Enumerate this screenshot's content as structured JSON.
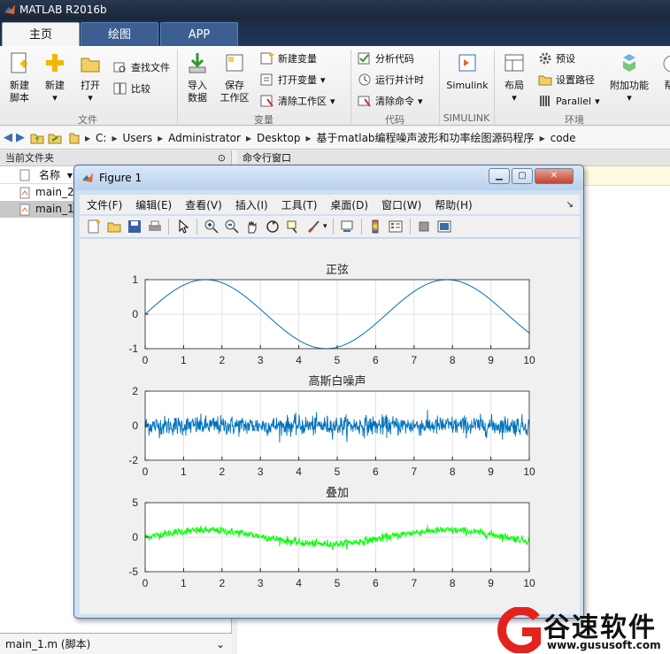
{
  "app": {
    "title": "MATLAB R2016b"
  },
  "tabs": [
    {
      "label": "主页"
    },
    {
      "label": "绘图"
    },
    {
      "label": "APP"
    }
  ],
  "ribbon": {
    "new_script": "新建\n脚本",
    "new": "新建",
    "open": "打开",
    "find_files": "查找文件",
    "compare": "比较",
    "import_data": "导入\n数据",
    "save_workspace": "保存\n工作区",
    "new_variable": "新建变量",
    "open_variable": "打开变量",
    "clear_workspace": "清除工作区",
    "analyze_code": "分析代码",
    "run_and_time": "运行并计时",
    "clear_commands": "清除命令",
    "simulink": "Simulink",
    "layout": "布局",
    "preferences": "预设",
    "set_path": "设置路径",
    "parallel": "Parallel",
    "addons": "附加功能",
    "help_partial": "帮",
    "groups": {
      "file": "文件",
      "variable": "变量",
      "code": "代码",
      "simulink": "SIMULINK",
      "environment": "环境"
    }
  },
  "address": {
    "crumbs": [
      "C:",
      "Users",
      "Administrator",
      "Desktop",
      "基于matlab编程噪声波形和功率绘图源码程序",
      "code"
    ]
  },
  "current_folder": {
    "title": "当前文件夹",
    "col_name": "名称",
    "files": [
      "main_2.m",
      "main_1.m"
    ],
    "status": "main_1.m  (脚本)"
  },
  "command_window": {
    "title": "命令行窗口"
  },
  "figure": {
    "title": "Figure 1",
    "menu": [
      "文件(F)",
      "编辑(E)",
      "查看(V)",
      "插入(I)",
      "工具(T)",
      "桌面(D)",
      "窗口(W)",
      "帮助(H)"
    ]
  },
  "watermark": {
    "text": "谷速软件",
    "url": "www.gususoft.com"
  },
  "colors": {
    "sine": "#0072bd",
    "noise": "#0072bd",
    "sum": "#00ff00",
    "accent": "#e4231e"
  },
  "chart_data": [
    {
      "type": "line",
      "title": "正弦",
      "xlim": [
        0,
        10
      ],
      "ylim": [
        -1,
        1
      ],
      "xticks": [
        0,
        1,
        2,
        3,
        4,
        5,
        6,
        7,
        8,
        9,
        10
      ],
      "yticks": [
        -1,
        0,
        1
      ],
      "grid": true,
      "series": [
        {
          "function": "sin(x)"
        }
      ]
    },
    {
      "type": "line",
      "title": "高斯白噪声",
      "xlim": [
        0,
        10
      ],
      "ylim": [
        -2,
        2
      ],
      "xticks": [
        0,
        1,
        2,
        3,
        4,
        5,
        6,
        7,
        8,
        9,
        10
      ],
      "yticks": [
        -2,
        0,
        2
      ],
      "grid": true,
      "series": [
        {
          "function": "gaussian noise, std≈0.3"
        }
      ]
    },
    {
      "type": "line",
      "title": "叠加",
      "xlim": [
        0,
        10
      ],
      "ylim": [
        -5,
        5
      ],
      "xticks": [
        0,
        1,
        2,
        3,
        4,
        5,
        6,
        7,
        8,
        9,
        10
      ],
      "yticks": [
        -5,
        0,
        5
      ],
      "grid": true,
      "series": [
        {
          "function": "sin(x) + noise"
        }
      ]
    }
  ]
}
